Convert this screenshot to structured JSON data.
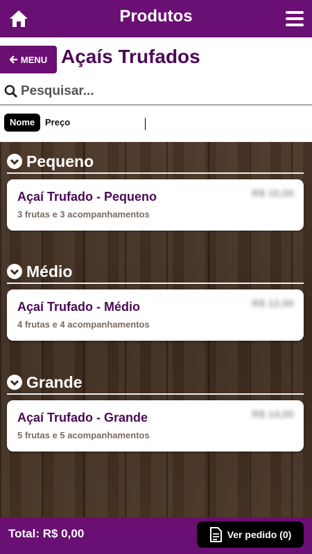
{
  "header": {
    "title": "Produtos",
    "home_icon": "home-icon",
    "menu_icon": "hamburger-icon"
  },
  "subheader": {
    "menu_label": "MENU",
    "page_title": "Açaís Trufados"
  },
  "search": {
    "placeholder": "Pesquisar...",
    "value": ""
  },
  "sort": {
    "name_label": "Nome",
    "price_label": "Preço",
    "active": "Nome"
  },
  "sections": [
    {
      "title": "Pequeno",
      "item": {
        "name": "Açaí Trufado - Pequeno",
        "desc": "3 frutas e 3 acompanhamentos",
        "price": "R$ 10,00"
      }
    },
    {
      "title": "Médio",
      "item": {
        "name": "Açaí Trufado - Médio",
        "desc": "4 frutas e 4 acompanhamentos",
        "price": "R$ 12,00"
      }
    },
    {
      "title": "Grande",
      "item": {
        "name": "Açaí Trufado - Grande",
        "desc": "5 frutas e 5 acompanhamentos",
        "price": "R$ 14,00"
      }
    }
  ],
  "footer": {
    "total": "Total: R$ 0,00",
    "order_button": "Ver pedido (0)"
  },
  "colors": {
    "brand": "#6a0f73",
    "title_text": "#4b0a55"
  }
}
